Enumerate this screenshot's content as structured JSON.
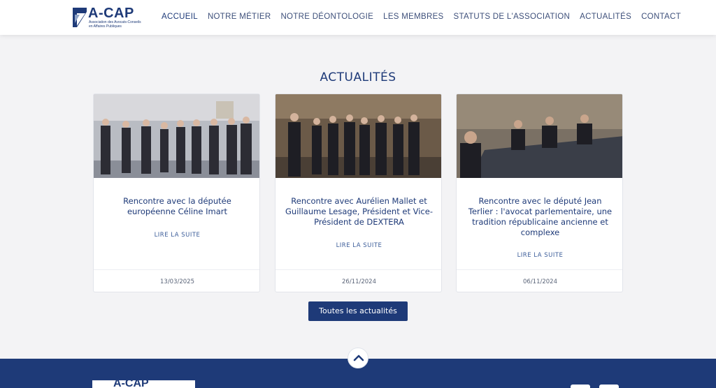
{
  "header": {
    "logo": {
      "title": "A-CAP",
      "subtitle": "Association des Avocats-Conseils en Affaires Publiques"
    },
    "nav": [
      {
        "label": "ACCUEIL",
        "active": true
      },
      {
        "label": "NOTRE MÉTIER",
        "active": false
      },
      {
        "label": "NOTRE DÉONTOLOGIE",
        "active": false
      },
      {
        "label": "LES MEMBRES",
        "active": false
      },
      {
        "label": "STATUTS DE L'ASSOCIATION",
        "active": false
      },
      {
        "label": "ACTUALITÉS",
        "active": false
      },
      {
        "label": "CONTACT",
        "active": false
      }
    ]
  },
  "news": {
    "title": "ACTUALITÉS",
    "cards": [
      {
        "title": "Rencontre avec la députée européenne Céline Imart",
        "more": "LIRE LA SUITE",
        "date": "13/03/2025"
      },
      {
        "title": "Rencontre avec Aurélien Mallet et Guillaume Lesage, Président et Vice-Président de DEXTERA",
        "more": "LIRE LA SUITE",
        "date": "26/11/2024"
      },
      {
        "title": "Rencontre avec le député Jean Terlier : l'avocat parlementaire, une tradition républicaine ancienne et complexe",
        "more": "LIRE LA SUITE",
        "date": "06/11/2024"
      }
    ],
    "all_button": "Toutes les actualités"
  },
  "footer": {
    "logo_text": "A-CAP",
    "scroll_top_icon": "chevron-up-icon"
  },
  "colors": {
    "brand": "#1e3a78",
    "background": "#f3f3f5",
    "card": "#ffffff"
  }
}
